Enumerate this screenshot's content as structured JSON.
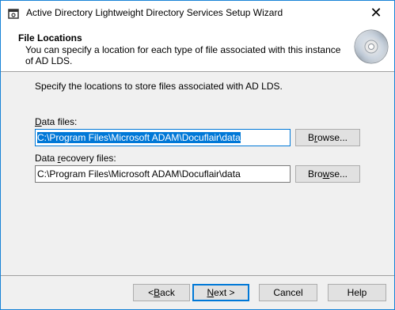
{
  "window": {
    "title": "Active Directory Lightweight Directory Services Setup Wizard",
    "close_glyph": "✕"
  },
  "header": {
    "heading": "File Locations",
    "description": "You can specify a location for each type of file associated with this instance of AD LDS."
  },
  "instruction": "Specify the locations to store files associated with AD LDS.",
  "data_files": {
    "label_prefix": "",
    "label_access": "D",
    "label_suffix": "ata files:",
    "value": "C:\\Program Files\\Microsoft ADAM\\Docuflair\\data",
    "browse_prefix": "B",
    "browse_access": "r",
    "browse_suffix": "owse..."
  },
  "recovery_files": {
    "label_prefix": "Data ",
    "label_access": "r",
    "label_suffix": "ecovery files:",
    "value": "C:\\Program Files\\Microsoft ADAM\\Docuflair\\data",
    "browse_prefix": "Bro",
    "browse_access": "w",
    "browse_suffix": "se..."
  },
  "footer": {
    "back_prefix": "< ",
    "back_access": "B",
    "back_suffix": "ack",
    "next_prefix": "",
    "next_access": "N",
    "next_suffix": "ext >",
    "cancel": "Cancel",
    "help": "Help"
  }
}
